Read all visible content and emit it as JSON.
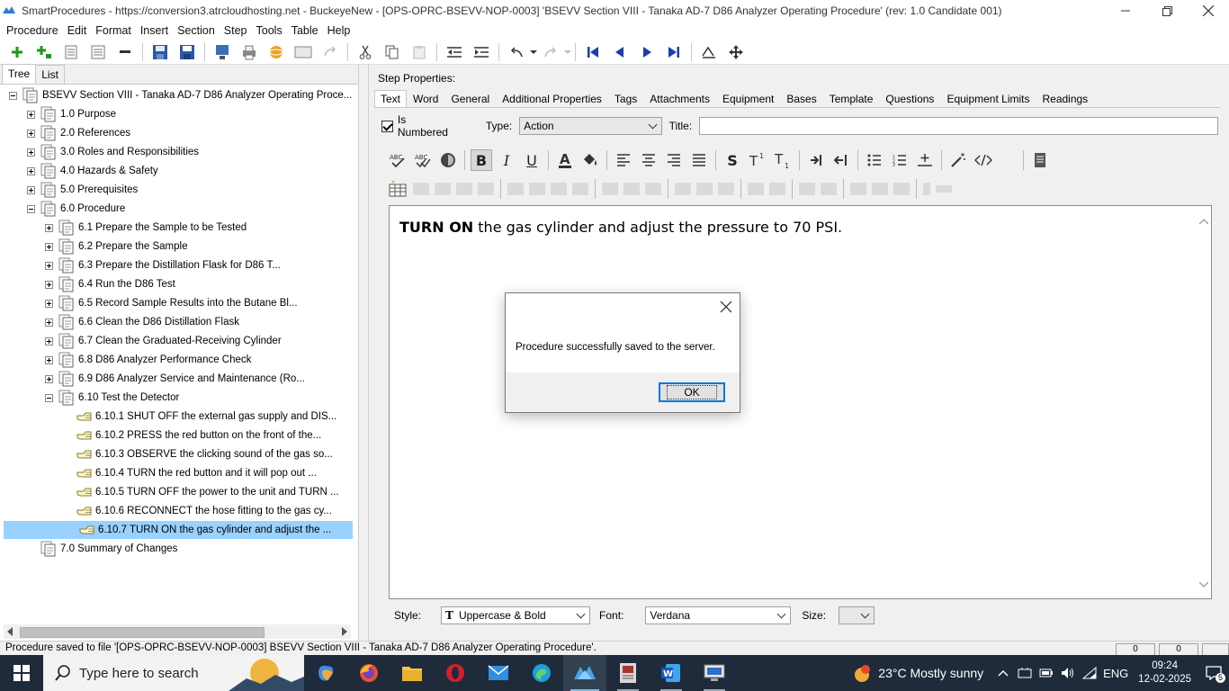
{
  "window": {
    "title": "SmartProcedures - https://conversion3.atrcloudhosting.net - BuckeyeNew - [OPS-OPRC-BSEVV-NOP-0003] 'BSEVV Section VIII - Tanaka AD-7 D86 Analyzer Operating Procedure' (rev: 1.0 Candidate 001)"
  },
  "menu": [
    "Procedure",
    "Edit",
    "Format",
    "Insert",
    "Section",
    "Step",
    "Tools",
    "Table",
    "Help"
  ],
  "left_tabs": [
    "Tree",
    "List"
  ],
  "tree": {
    "root": "BSEVV Section VIII - Tanaka AD-7 D86 Analyzer Operating Proce...",
    "sections": [
      "1.0 Purpose",
      "2.0 References",
      "3.0 Roles and Responsibilities",
      "4.0 Hazards & Safety",
      "5.0 Prerequisites",
      "6.0 Procedure"
    ],
    "subsections": [
      "6.1 Prepare the Sample to be Tested",
      "6.2 Prepare the Sample",
      "6.3 Prepare the Distillation Flask for D86 T...",
      "6.4 Run the D86 Test",
      "6.5 Record Sample Results into the Butane Bl...",
      "6.6 Clean the D86 Distillation Flask",
      "6.7 Clean the Graduated-Receiving Cylinder",
      "6.8 D86 Analyzer Performance Check",
      "6.9 D86 Analyzer Service and Maintenance (Ro...",
      "6.10 Test the Detector"
    ],
    "steps": [
      "6.10.1 SHUT OFF the external gas supply and DIS...",
      "6.10.2 PRESS the red button on the front of the...",
      "6.10.3 OBSERVE the clicking sound of the gas so...",
      "6.10.4 TURN the red button and it will pop out ...",
      "6.10.5 TURN OFF the power to the unit and TURN ...",
      "6.10.6 RECONNECT the hose fitting to the gas cy...",
      "6.10.7 TURN ON the gas cylinder and adjust the ..."
    ],
    "last": "7.0 Summary of Changes"
  },
  "step_properties": {
    "heading": "Step Properties:",
    "tabs": [
      "Text",
      "Word",
      "General",
      "Additional Properties",
      "Tags",
      "Attachments",
      "Equipment",
      "Bases",
      "Template",
      "Questions",
      "Equipment Limits",
      "Readings"
    ],
    "is_numbered_label": "Is Numbered",
    "type_label": "Type:",
    "type_value": "Action",
    "title_label": "Title:",
    "title_value": ""
  },
  "editor": {
    "bold_text": "TURN ON",
    "rest_text": " the gas cylinder and adjust the pressure to 70 PSI."
  },
  "bottom": {
    "style_label": "Style:",
    "style_value": "Uppercase & Bold",
    "font_label": "Font:",
    "font_value": "Verdana",
    "size_label": "Size:",
    "size_value": ""
  },
  "status": {
    "text": "Procedure saved to file '[OPS-OPRC-BSEVV-NOP-0003] BSEVV Section VIII - Tanaka AD-7 D86 Analyzer Operating Procedure'.",
    "box1": "0",
    "box2": "0"
  },
  "dialog": {
    "message": "Procedure successfully saved to the server.",
    "ok_label": "OK"
  },
  "taskbar": {
    "search_placeholder": "Type here to search",
    "weather": "23°C  Mostly sunny",
    "lang": "ENG",
    "time": "09:24",
    "date": "12-02-2025",
    "notifications": "5"
  },
  "colors": {
    "selection": "#99d1ff",
    "accent": "#0078d7",
    "taskbar": "#1f2b3a"
  }
}
